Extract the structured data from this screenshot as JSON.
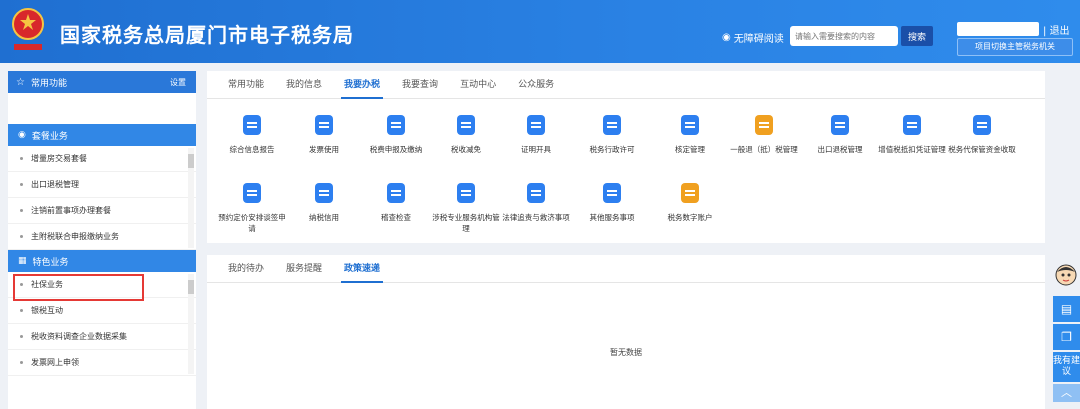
{
  "header": {
    "title": "国家税务总局厦门市电子税务局",
    "accessibility": "无障碍阅读",
    "search_placeholder": "请输入需要搜索的内容",
    "search_button": "搜索",
    "logout": "退出",
    "switch_button": "项目切换主管税务机关"
  },
  "sidebar": {
    "common": {
      "title": "常用功能",
      "action": "设置"
    },
    "package": {
      "title": "套餐业务",
      "items": [
        "增量房交易套餐",
        "出口退税管理",
        "注销前置事项办理套餐",
        "主附税联合申报缴纳业务"
      ]
    },
    "special": {
      "title": "特色业务",
      "items": [
        "社保业务",
        "银税互动",
        "税收资料调查企业数据采集",
        "发票网上申领"
      ]
    }
  },
  "top_tabs": [
    "常用功能",
    "我的信息",
    "我要办税",
    "我要查询",
    "互动中心",
    "公众服务"
  ],
  "services": [
    "综合信息报告",
    "发票使用",
    "税费申报及缴纳",
    "税收减免",
    "证明开具",
    "税务行政许可",
    "核定管理",
    "一般退（抵）税管理",
    "出口退税管理",
    "增值税抵扣凭证管理",
    "税务代保管资金收取",
    "预约定价安排谈签申请",
    "纳税信用",
    "稽查检查",
    "涉税专业服务机构管理",
    "法律追责与救济事项",
    "其他服务事项",
    "税务数字账户"
  ],
  "bottom_tabs": [
    "我的待办",
    "服务提醒",
    "政策速递"
  ],
  "empty_text": "暂无数据",
  "rail": {
    "suggest": "我有建议"
  },
  "colors": {
    "primary": "#1f6fd1",
    "highlight": "#e53935"
  }
}
